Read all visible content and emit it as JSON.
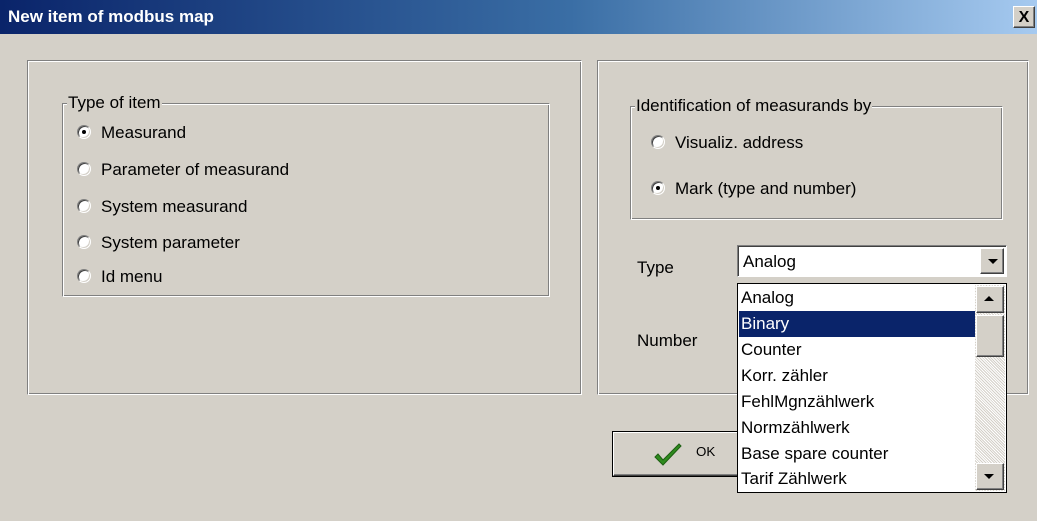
{
  "window": {
    "title": "New item of modbus map",
    "close_label": "X"
  },
  "type_of_item": {
    "legend": "Type of item",
    "options": [
      {
        "label": "Measurand",
        "checked": true
      },
      {
        "label": "Parameter of measurand",
        "checked": false
      },
      {
        "label": "System measurand",
        "checked": false
      },
      {
        "label": "System parameter",
        "checked": false
      },
      {
        "label": "Id menu",
        "checked": false
      }
    ]
  },
  "identification": {
    "legend": "Identification of measurands by",
    "options": [
      {
        "label": "Visualiz. address",
        "checked": false
      },
      {
        "label": "Mark (type and number)",
        "checked": true
      }
    ]
  },
  "type_field": {
    "label": "Type",
    "value": "Analog",
    "options": [
      "Analog",
      "Binary",
      "Counter",
      "Korr. zähler",
      "FehlMgnzählwerk",
      "Normzählwerk",
      "Base spare counter",
      "Tarif Zählwerk"
    ],
    "highlighted_option": "Binary"
  },
  "number_field": {
    "label": "Number"
  },
  "buttons": {
    "ok_label": "OK"
  },
  "colors": {
    "title_bar": "#0a246a",
    "face": "#d4d0c8",
    "highlight": "#0a246a",
    "check_icon": "#2e8b1e"
  },
  "icons": {
    "ok": "checkmark-icon",
    "close": "close-icon"
  }
}
